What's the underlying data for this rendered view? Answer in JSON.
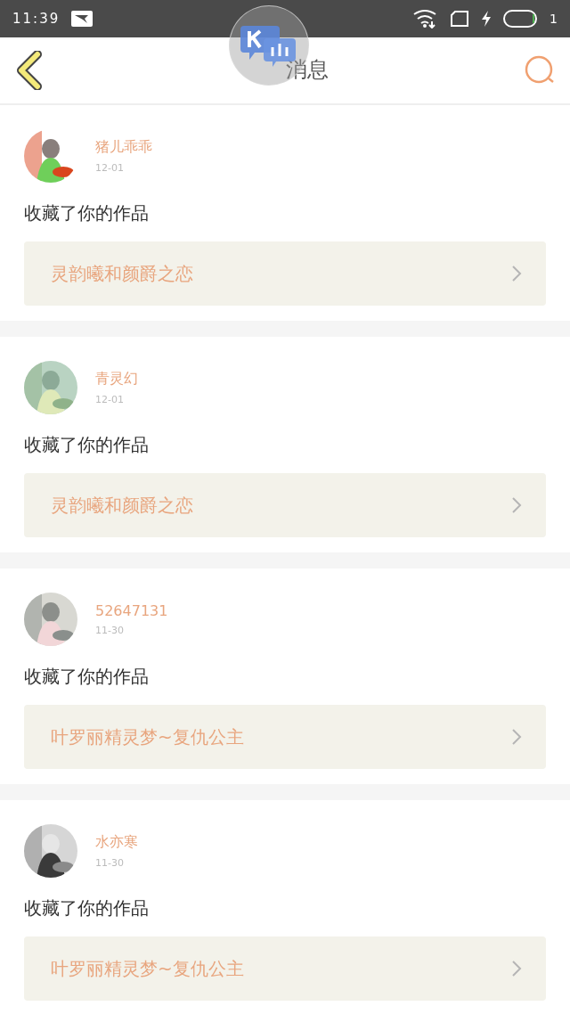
{
  "status_bar": {
    "time": "11:39",
    "right_text": "1"
  },
  "header": {
    "title": "消息"
  },
  "messages": [
    {
      "name": "猪儿乖乖",
      "date": "12-01",
      "action": "收藏了你的作品",
      "work_title": "灵韵曦和颜爵之恋"
    },
    {
      "name": "青灵幻",
      "date": "12-01",
      "action": "收藏了你的作品",
      "work_title": "灵韵曦和颜爵之恋"
    },
    {
      "name": "52647131",
      "date": "11-30",
      "action": "收藏了你的作品",
      "work_title": "叶罗丽精灵梦~复仇公主"
    },
    {
      "name": "水亦寒",
      "date": "11-30",
      "action": "收藏了你的作品",
      "work_title": "叶罗丽精灵梦~复仇公主"
    }
  ]
}
